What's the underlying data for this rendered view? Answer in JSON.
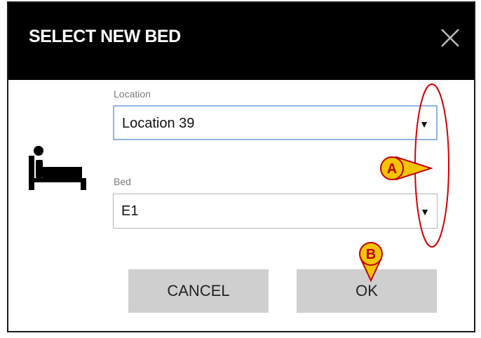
{
  "dialog": {
    "title": "SELECT NEW BED",
    "close_icon": "close-icon",
    "bed_icon": "bed-icon"
  },
  "location": {
    "label": "Location",
    "value": "Location 39"
  },
  "bed": {
    "label": "Bed",
    "value": "E1"
  },
  "buttons": {
    "cancel": "CANCEL",
    "ok": "OK"
  },
  "annotations": {
    "a": "A",
    "b": "B",
    "marker_color": "#f5c400",
    "ellipse_color": "#d40000"
  },
  "colors": {
    "titlebar": "#000000",
    "button_bg": "#cfcfcf",
    "focus_border": "#8fb4e3"
  }
}
